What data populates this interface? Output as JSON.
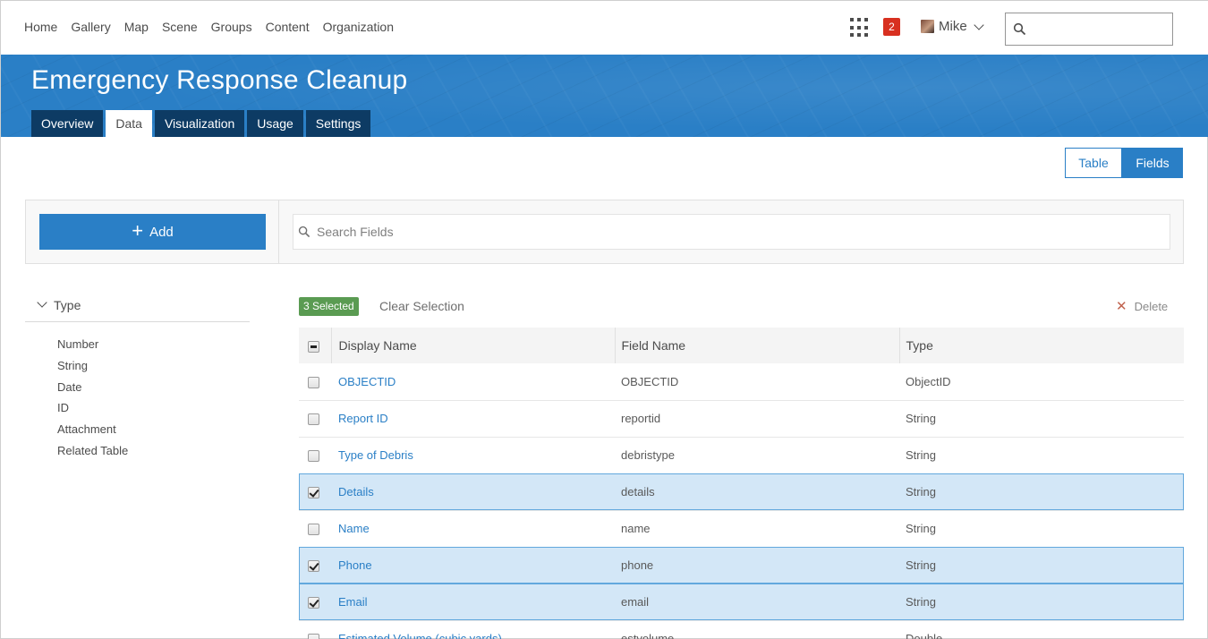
{
  "nav": {
    "links": [
      "Home",
      "Gallery",
      "Map",
      "Scene",
      "Groups",
      "Content",
      "Organization"
    ],
    "notification_count": "2",
    "user_name": "Mike",
    "search_value": ""
  },
  "banner": {
    "title": "Emergency Response Cleanup",
    "tabs": [
      "Overview",
      "Data",
      "Visualization",
      "Usage",
      "Settings"
    ],
    "active_tab": "Data"
  },
  "view_toggle": {
    "table_label": "Table",
    "fields_label": "Fields",
    "active": "Fields"
  },
  "actions": {
    "add_label": "Add",
    "search_placeholder": "Search Fields"
  },
  "filter": {
    "heading": "Type",
    "items": [
      "Number",
      "String",
      "Date",
      "ID",
      "Attachment",
      "Related Table"
    ]
  },
  "selection": {
    "badge": "3 Selected",
    "clear_label": "Clear Selection",
    "delete_label": "Delete"
  },
  "table": {
    "columns": [
      "Display Name",
      "Field Name",
      "Type"
    ],
    "rows": [
      {
        "display": "OBJECTID",
        "field": "OBJECTID",
        "type": "ObjectID",
        "selected": false
      },
      {
        "display": "Report ID",
        "field": "reportid",
        "type": "String",
        "selected": false
      },
      {
        "display": "Type of Debris",
        "field": "debristype",
        "type": "String",
        "selected": false
      },
      {
        "display": "Details",
        "field": "details",
        "type": "String",
        "selected": true
      },
      {
        "display": "Name",
        "field": "name",
        "type": "String",
        "selected": false
      },
      {
        "display": "Phone",
        "field": "phone",
        "type": "String",
        "selected": true
      },
      {
        "display": "Email",
        "field": "email",
        "type": "String",
        "selected": true
      },
      {
        "display": "Estimated Volume (cubic yards)",
        "field": "estvolume",
        "type": "Double",
        "selected": false
      }
    ]
  },
  "colors": {
    "accent": "#2a7fc6",
    "tab_dark": "#0d3b64",
    "selected_row": "#d3e7f7",
    "badge_green": "#5a9b52",
    "notif_red": "#d83020"
  }
}
